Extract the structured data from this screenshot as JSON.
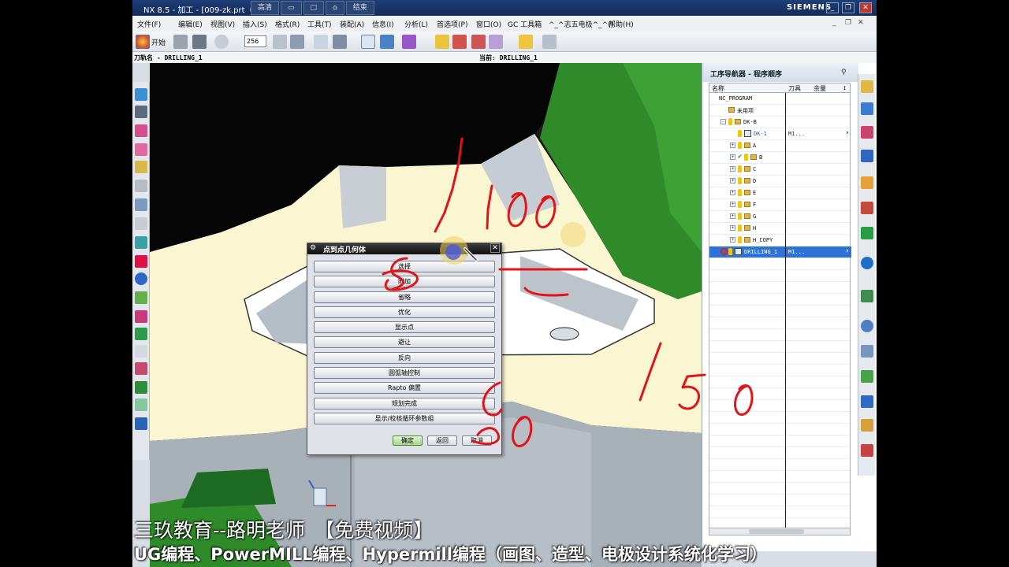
{
  "window": {
    "title": "NX 8.5 - 加工 - [009-zk.prt（修",
    "center_buttons": [
      "高清",
      "",
      "",
      "",
      "结束"
    ],
    "brand": "SIEMENS",
    "controls": [
      "_",
      "❐",
      "✕"
    ]
  },
  "menubar": {
    "items": [
      "文件(F)",
      "编辑(E)",
      "视图(V)",
      "插入(S)",
      "格式(R)",
      "工具(T)",
      "装配(A)",
      "信息(I)",
      "分析(L)",
      "首选项(P)",
      "窗口(O)",
      "GC 工具箱",
      "^_^志五电极^_^()",
      "帮助(H)"
    ],
    "right_controls": [
      "_",
      "❐",
      "✕"
    ]
  },
  "toolbar": {
    "start_label": "开始",
    "combo_value": "256"
  },
  "status": {
    "toolpath_name": "刀轨名 - DRILLING_1",
    "current": "当前: DRILLING_1"
  },
  "navigator": {
    "title": "工序导航器 - 程序顺序",
    "columns": [
      "名称",
      "刀具",
      "余量",
      "ɪ"
    ],
    "rows": [
      {
        "name": "NC_PROGRAM",
        "tool": "",
        "indent": 0
      },
      {
        "name": "未用项",
        "tool": "",
        "indent": 1
      },
      {
        "name": "DK-B",
        "tool": "",
        "indent": 1
      },
      {
        "name": "DK-1",
        "tool": "M1...",
        "indent": 2
      },
      {
        "name": "A",
        "tool": "",
        "indent": 2
      },
      {
        "name": "B",
        "tool": "",
        "indent": 2
      },
      {
        "name": "C",
        "tool": "",
        "indent": 2
      },
      {
        "name": "D",
        "tool": "",
        "indent": 2
      },
      {
        "name": "E",
        "tool": "",
        "indent": 2
      },
      {
        "name": "F",
        "tool": "",
        "indent": 2
      },
      {
        "name": "G",
        "tool": "",
        "indent": 2
      },
      {
        "name": "H",
        "tool": "",
        "indent": 2
      },
      {
        "name": "H_COPY",
        "tool": "",
        "indent": 2
      },
      {
        "name": "DRILLING_1",
        "tool": "M1...",
        "indent": 1
      }
    ]
  },
  "dialog": {
    "title": "点到点几何体",
    "buttons": [
      "选择",
      "附加",
      "省略",
      "优化",
      "显示点",
      "避让",
      "反向",
      "圆弧轴控制",
      "Rapto 偏置",
      "规划完成",
      "显示/校核循环参数组"
    ],
    "ok": "确定",
    "back": "返回",
    "cancel": "取消"
  },
  "colors": {
    "part_green": "#2f8a2a",
    "part_cream": "#fbf6d2",
    "part_gray": "#b9c0c8",
    "ink": "#e0151a",
    "selection": "#2d73d7"
  },
  "caption": {
    "line1": "三玖教育--路明老师　【免费视频】",
    "line2": "UG编程、PowerMILL编程、Hypermill编程（画图、造型、电极设计系统化学习）"
  }
}
